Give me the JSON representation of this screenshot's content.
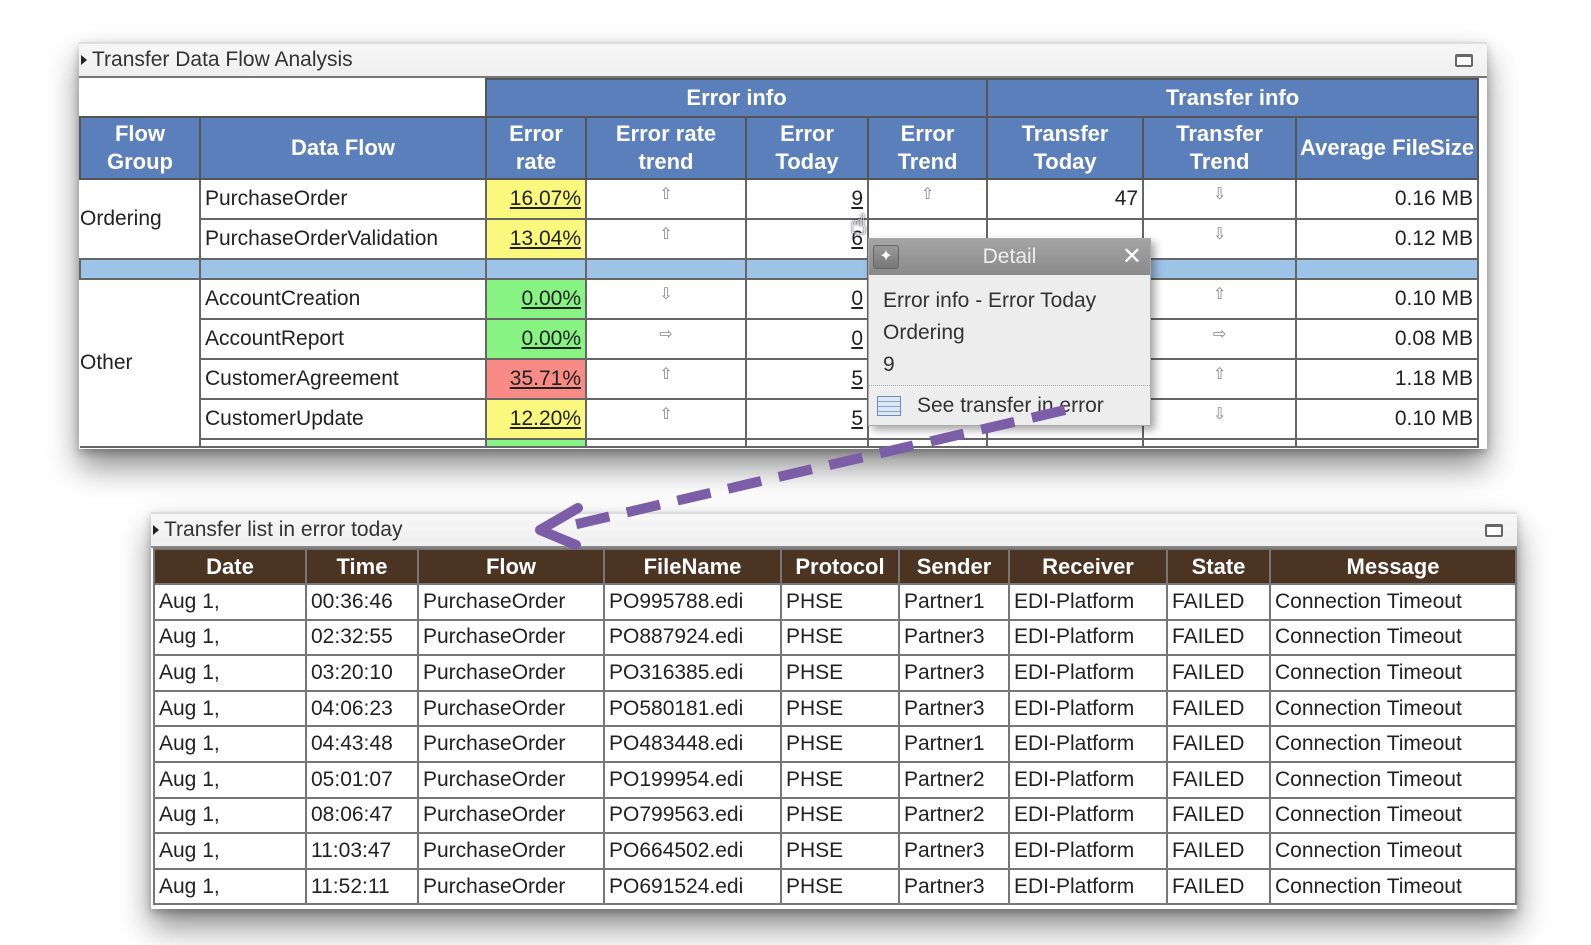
{
  "top_panel": {
    "title": "Transfer Data Flow Analysis",
    "group_headers": [
      "Error info",
      "Transfer info"
    ],
    "columns": [
      "Flow Group",
      "Data Flow",
      "Error rate",
      "Error rate trend",
      "Error Today",
      "Error Trend",
      "Transfer Today",
      "Transfer Trend",
      "Average FileSize"
    ],
    "groups": [
      {
        "name": "Ordering",
        "rows": [
          {
            "flow": "PurchaseOrder",
            "error_rate": "16.07%",
            "rate_color": "#fbf97d",
            "rate_trend": "up",
            "error_today": "9",
            "error_trend": "up",
            "transfer_today": "47",
            "transfer_trend": "down",
            "avg_size": "0.16 MB"
          },
          {
            "flow": "PurchaseOrderValidation",
            "error_rate": "13.04%",
            "rate_color": "#fbf97d",
            "rate_trend": "up",
            "error_today": "6",
            "error_trend": "",
            "transfer_today": "",
            "transfer_trend": "down",
            "avg_size": "0.12 MB"
          }
        ]
      },
      {
        "name": "Other",
        "rows": [
          {
            "flow": "AccountCreation",
            "error_rate": "0.00%",
            "rate_color": "#86f383",
            "rate_trend": "down",
            "error_today": "0",
            "error_trend": "",
            "transfer_today": "",
            "transfer_trend": "up",
            "avg_size": "0.10 MB"
          },
          {
            "flow": "AccountReport",
            "error_rate": "0.00%",
            "rate_color": "#86f383",
            "rate_trend": "right",
            "error_today": "0",
            "error_trend": "",
            "transfer_today": "",
            "transfer_trend": "right",
            "avg_size": "0.08 MB"
          },
          {
            "flow": "CustomerAgreement",
            "error_rate": "35.71%",
            "rate_color": "#f88b85",
            "rate_trend": "up",
            "error_today": "5",
            "error_trend": "",
            "transfer_today": "",
            "transfer_trend": "up",
            "avg_size": "1.18 MB"
          },
          {
            "flow": "CustomerUpdate",
            "error_rate": "12.20%",
            "rate_color": "#fbf97d",
            "rate_trend": "up",
            "error_today": "5",
            "error_trend": "",
            "transfer_today": "",
            "transfer_trend": "down",
            "avg_size": "0.10 MB"
          }
        ]
      }
    ],
    "partial_row_rate_color": "#86f383"
  },
  "popup": {
    "title": "Detail",
    "lines": [
      "Error info - Error Today",
      "Ordering",
      "9"
    ],
    "link_label": "See transfer in error"
  },
  "bottom_panel": {
    "title": "Transfer list in error today",
    "columns": [
      "Date",
      "Time",
      "Flow",
      "FileName",
      "Protocol",
      "Sender",
      "Receiver",
      "State",
      "Message"
    ],
    "rows": [
      [
        "Aug 1,",
        "00:36:46",
        "PurchaseOrder",
        "PO995788.edi",
        "PHSE",
        "Partner1",
        "EDI-Platform",
        "FAILED",
        "Connection Timeout"
      ],
      [
        "Aug 1,",
        "02:32:55",
        "PurchaseOrder",
        "PO887924.edi",
        "PHSE",
        "Partner3",
        "EDI-Platform",
        "FAILED",
        "Connection Timeout"
      ],
      [
        "Aug 1,",
        "03:20:10",
        "PurchaseOrder",
        "PO316385.edi",
        "PHSE",
        "Partner3",
        "EDI-Platform",
        "FAILED",
        "Connection Timeout"
      ],
      [
        "Aug 1,",
        "04:06:23",
        "PurchaseOrder",
        "PO580181.edi",
        "PHSE",
        "Partner3",
        "EDI-Platform",
        "FAILED",
        "Connection Timeout"
      ],
      [
        "Aug 1,",
        "04:43:48",
        "PurchaseOrder",
        "PO483448.edi",
        "PHSE",
        "Partner1",
        "EDI-Platform",
        "FAILED",
        "Connection Timeout"
      ],
      [
        "Aug 1,",
        "05:01:07",
        "PurchaseOrder",
        "PO199954.edi",
        "PHSE",
        "Partner2",
        "EDI-Platform",
        "FAILED",
        "Connection Timeout"
      ],
      [
        "Aug 1,",
        "08:06:47",
        "PurchaseOrder",
        "PO799563.edi",
        "PHSE",
        "Partner2",
        "EDI-Platform",
        "FAILED",
        "Connection Timeout"
      ],
      [
        "Aug 1,",
        "11:03:47",
        "PurchaseOrder",
        "PO664502.edi",
        "PHSE",
        "Partner3",
        "EDI-Platform",
        "FAILED",
        "Connection Timeout"
      ],
      [
        "Aug 1,",
        "11:52:11",
        "PurchaseOrder",
        "PO691524.edi",
        "PHSE",
        "Partner3",
        "EDI-Platform",
        "FAILED",
        "Connection Timeout"
      ]
    ]
  },
  "colors": {
    "top_header": "#5b7fba",
    "bottom_header": "#4b3421",
    "separator_row": "#9dc3e6",
    "arrow": "#7b5ea7"
  },
  "icons": {
    "up": "⇧",
    "down": "⇩",
    "right": "⇨",
    "pin": "pin-icon",
    "close": "✕",
    "cursor": "hand-pointer-icon"
  }
}
